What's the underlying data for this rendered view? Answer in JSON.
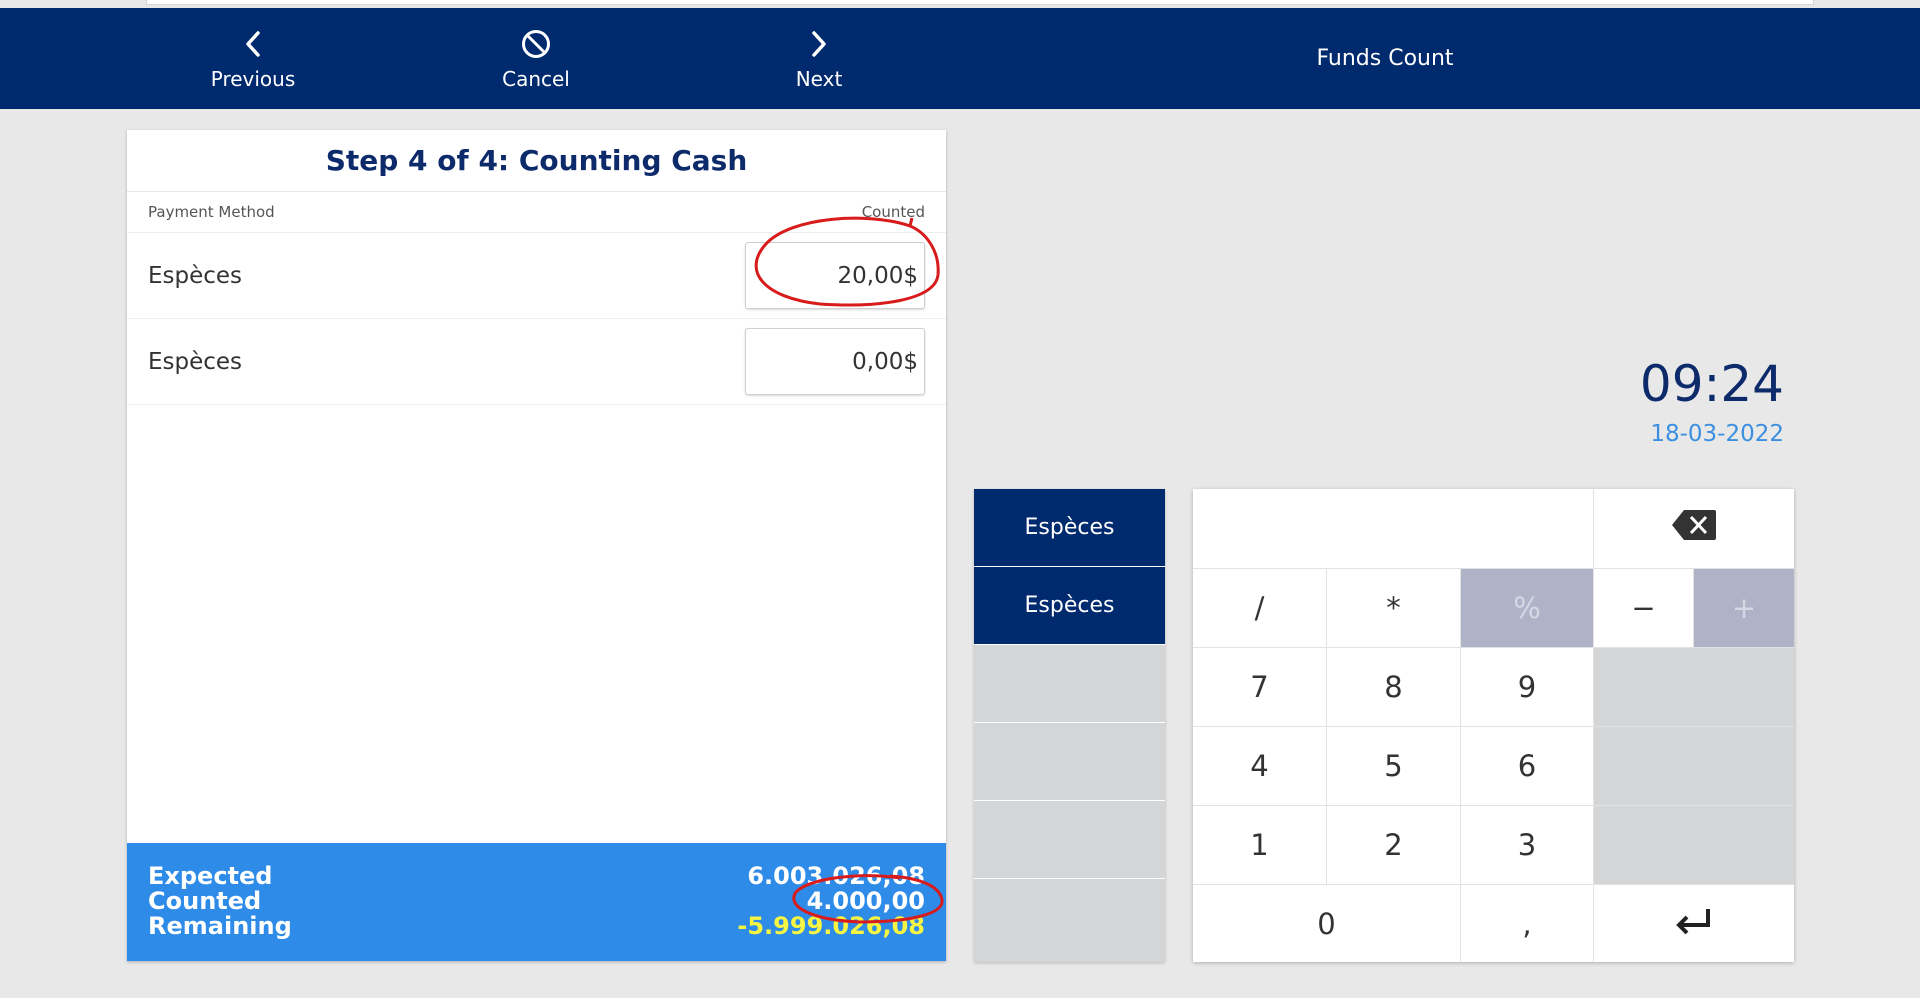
{
  "header": {
    "previous_label": "Previous",
    "cancel_label": "Cancel",
    "next_label": "Next",
    "title": "Funds Count"
  },
  "panel": {
    "step_title": "Step 4 of 4: Counting Cash",
    "col_method": "Payment Method",
    "col_counted": "Counted",
    "rows": [
      {
        "method": "Espèces",
        "amount": "20,00$"
      },
      {
        "method": "Espèces",
        "amount": "0,00$"
      }
    ],
    "summary": {
      "expected_label": "Expected",
      "counted_label": "Counted",
      "remaining_label": "Remaining",
      "expected_value": "6.003.026,08",
      "counted_value": "4.000,00",
      "remaining_value": "-5.999.026,08"
    }
  },
  "clock": {
    "time": "09:24",
    "date": "18-03-2022"
  },
  "methods": [
    "Espèces",
    "Espèces"
  ],
  "keypad": {
    "divide": "/",
    "multiply": "*",
    "percent": "%",
    "minus": "−",
    "plus": "+",
    "k7": "7",
    "k8": "8",
    "k9": "9",
    "k4": "4",
    "k5": "5",
    "k6": "6",
    "k1": "1",
    "k2": "2",
    "k3": "3",
    "k0": "0",
    "decimal": ","
  },
  "colors": {
    "header_bg": "#002a6e",
    "summary_bg": "#2e8be8",
    "negative_text": "#f5f542",
    "annotation": "#d81b1b"
  },
  "icons": [
    "chevron-left-icon",
    "cancel-circle-icon",
    "chevron-right-icon",
    "backspace-icon",
    "enter-icon"
  ]
}
